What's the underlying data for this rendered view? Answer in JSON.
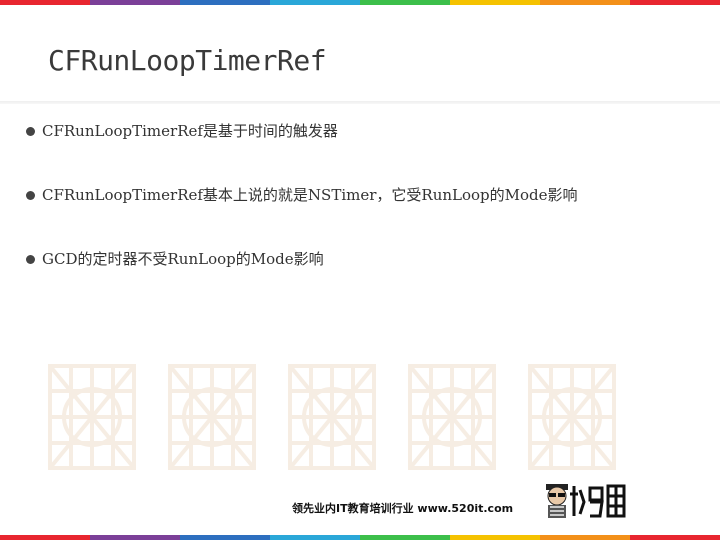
{
  "theme": {
    "stripe_colors": [
      "#e8262f",
      "#7b3f98",
      "#2d6fbf",
      "#2aa7d8",
      "#3cbf4a",
      "#f5c200",
      "#f39019",
      "#e8262f"
    ],
    "title_color": "#3a3a3a",
    "text_color": "#333333"
  },
  "slide": {
    "title": "CFRunLoopTimerRef",
    "bullets": [
      {
        "text": "CFRunLoopTimerRef是基于时间的触发器"
      },
      {
        "text": "CFRunLoopTimerRef基本上说的就是NSTimer，它受RunLoop的Mode影响"
      },
      {
        "text": "GCD的定时器不受RunLoop的Mode影响"
      }
    ]
  },
  "footer": {
    "tagline": "领先业内IT教育培训行业 www.520it.com",
    "logo_icon": "xiaoma-logo-icon"
  }
}
